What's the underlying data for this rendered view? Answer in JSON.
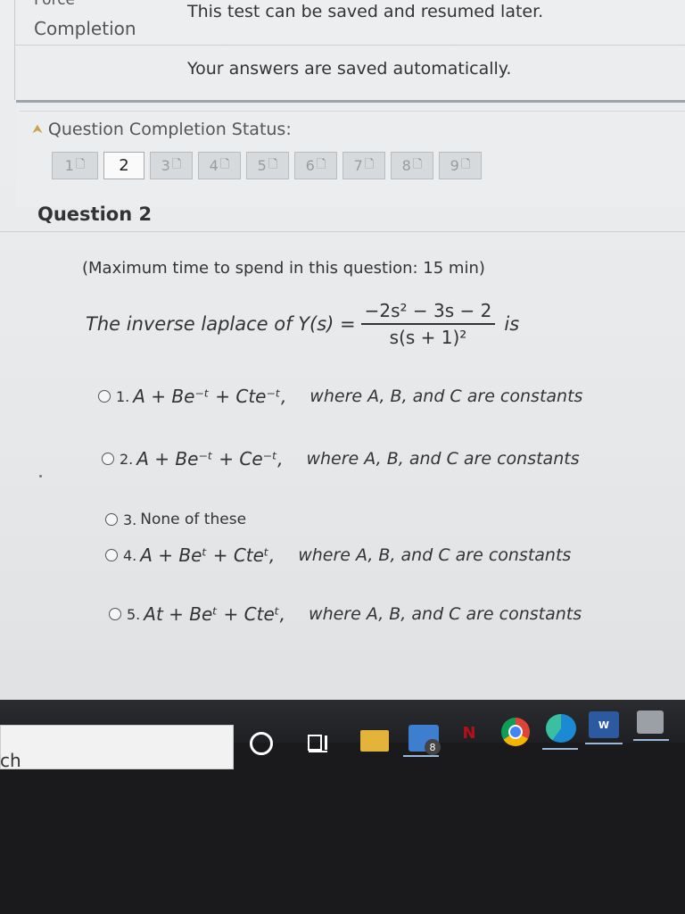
{
  "header": {
    "force_label": "Force",
    "completion_label": "Completion",
    "saved_resumed": "This test can be saved and resumed later.",
    "saved_auto": "Your answers are saved automatically."
  },
  "completion_status": {
    "title": "Question Completion Status:",
    "questions": [
      {
        "label": "1",
        "state": "answered"
      },
      {
        "label": "2",
        "state": "current"
      },
      {
        "label": "3",
        "state": "answered"
      },
      {
        "label": "4",
        "state": "answered"
      },
      {
        "label": "5",
        "state": "answered"
      },
      {
        "label": "6",
        "state": "answered"
      },
      {
        "label": "7",
        "state": "answered"
      },
      {
        "label": "8",
        "state": "answered"
      },
      {
        "label": "9",
        "state": "answered"
      }
    ]
  },
  "question": {
    "heading": "Question 2",
    "max_time": "(Maximum time to spend in this question: 15 min)",
    "prompt_prefix": "The inverse laplace of Y(s) =",
    "numerator": "−2s² − 3s − 2",
    "denominator": "s(s + 1)²",
    "prompt_suffix": "is",
    "options": [
      {
        "num": "1.",
        "expr": "A + Be⁻ᵗ + Cte⁻ᵗ,",
        "note": "where A, B, and C are constants"
      },
      {
        "num": "2.",
        "expr": "A + Be⁻ᵗ + Ce⁻ᵗ,",
        "note": "where A, B, and C are constants"
      },
      {
        "num": "3.",
        "plain": "None of these"
      },
      {
        "num": "4.",
        "expr": "A + Beᵗ + Cteᵗ,",
        "note": "where A, B, and C are constants"
      },
      {
        "num": "5.",
        "expr": "At + Beᵗ + Cteᵗ,",
        "note": "where A, B, and C are constants"
      }
    ]
  },
  "taskbar": {
    "search_text": "ch",
    "mail_badge": "8",
    "netflix_letter": "N",
    "word_letter": "W"
  }
}
